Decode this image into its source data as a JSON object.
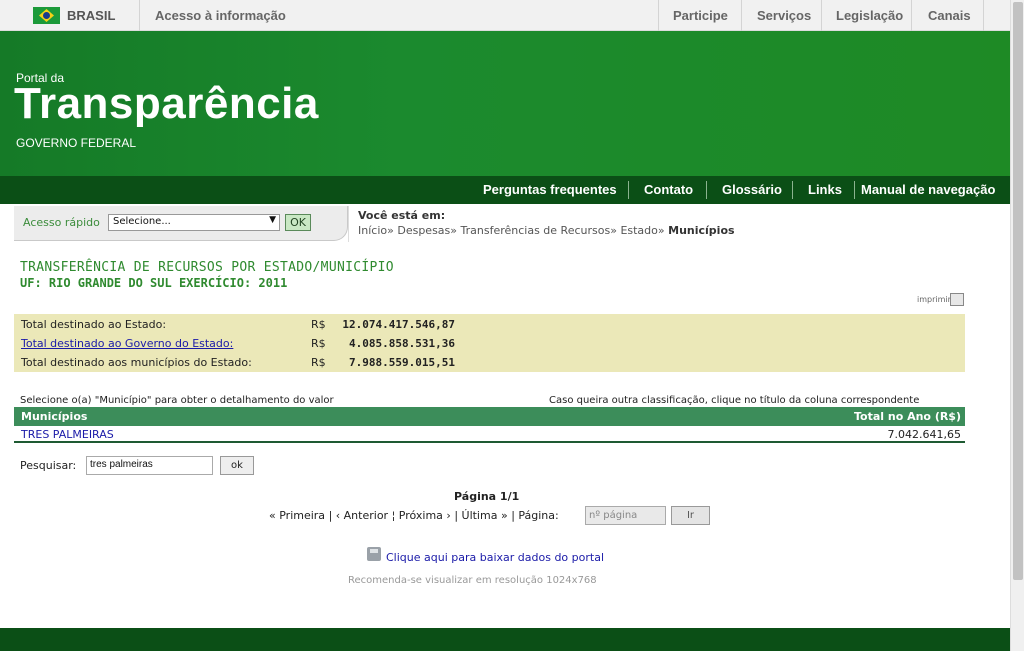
{
  "gov_bar": {
    "country": "BRASIL",
    "access": "Acesso à informação",
    "nav": [
      "Participe",
      "Serviços",
      "Legislação",
      "Canais"
    ]
  },
  "header": {
    "portal_da": "Portal da",
    "title": "Transparência",
    "subtitle": "GOVERNO FEDERAL"
  },
  "nav_bar": {
    "items": [
      "Perguntas frequentes",
      "Contato",
      "Glossário",
      "Links",
      "Manual de navegação"
    ]
  },
  "quick_access": {
    "label": "Acesso rápido",
    "select_value": "Selecione...",
    "ok": "OK"
  },
  "breadcrumb": {
    "title": "Você está em:",
    "items": [
      "Início»",
      "Despesas»",
      "Transferências de Recursos»",
      "Estado»"
    ],
    "current": "Municípios"
  },
  "title": {
    "line1": "TRANSFERÊNCIA DE RECURSOS POR ESTADO/MUNICÍPIO",
    "line2": "UF: RIO GRANDE DO SUL  EXERCÍCIO: 2011"
  },
  "print_label": "imprimir",
  "totals": [
    {
      "label": "Total destinado ao Estado:",
      "currency": "R$",
      "value": "12.074.417.546,87",
      "link": false
    },
    {
      "label": "Total destinado ao Governo do Estado:",
      "currency": "R$",
      "value": "4.085.858.531,36",
      "link": true
    },
    {
      "label": "Total destinado aos municípios do Estado:",
      "currency": "R$",
      "value": "7.988.559.015,51",
      "link": false
    }
  ],
  "table": {
    "hint_left": "Selecione o(a) \"Município\" para obter o detalhamento do valor",
    "hint_right": "Caso queira outra classificação, clique no título da coluna correspondente",
    "columns": [
      "Municípios",
      "Total no Ano (R$)"
    ],
    "rows": [
      {
        "municipio": "TRES PALMEIRAS",
        "total": "7.042.641,65"
      }
    ]
  },
  "search": {
    "label": "Pesquisar:",
    "value": "tres palmeiras",
    "button": "ok"
  },
  "pagination": {
    "label": "Página 1/1",
    "first": "« Primeira",
    "prev": "‹ Anterior",
    "next": "Próxima ›",
    "last": "Última »",
    "page_label": "Página:",
    "page_placeholder": "nº página",
    "go": "Ir"
  },
  "download": {
    "link": "Clique aqui para baixar dados do portal",
    "recommend": "Recomenda-se visualizar em resolução 1024x768"
  }
}
